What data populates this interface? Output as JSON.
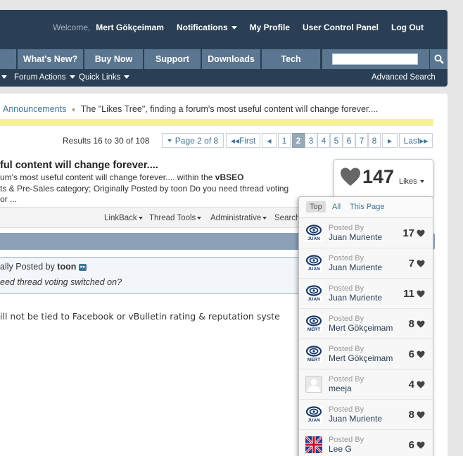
{
  "header": {
    "welcome": "Welcome,",
    "username": "Mert Gökçeimam",
    "links": [
      "Notifications",
      "My Profile",
      "User Control Panel",
      "Log Out"
    ]
  },
  "nav": {
    "tabs": [
      "What's New?",
      "Buy Now",
      "Support",
      "Downloads",
      "Tech"
    ],
    "search_placeholder": ""
  },
  "subnav": {
    "forum_actions": "Forum Actions",
    "quick_links": "Quick Links",
    "advanced_search": "Advanced Search"
  },
  "breadcrumb": {
    "parent": "Announcements",
    "current": "The \"Likes Tree\", finding a forum's most useful content will change forever...."
  },
  "results": {
    "text": "Results 16 to 30 of 108"
  },
  "pagination": {
    "page_of": "Page 2 of 8",
    "first": "First",
    "prev": "◂",
    "pages": [
      "1",
      "2",
      "3",
      "4",
      "5",
      "6",
      "7",
      "8"
    ],
    "current": "2",
    "next": "▸",
    "last": "Last"
  },
  "thread": {
    "title": "ful content will change forever....",
    "line1_pre": "um's most useful content will change forever.... within the ",
    "line1_bold": "vBSEO",
    "line2": "ts & Pre-Sales category; Originally Posted by toon Do you need thread voting",
    "line3": "or ..."
  },
  "toolbar": {
    "linkback": "LinkBack",
    "thread_tools": "Thread Tools",
    "administrative": "Administrative",
    "search": "Search"
  },
  "quote": {
    "prefix": "ally Posted by ",
    "author": "toon",
    "text": "eed thread voting switched on?"
  },
  "post": {
    "text": "ill not be tied to Facebook or vBulletin rating & reputation syste"
  },
  "likes": {
    "count": "147",
    "label": "Likes",
    "tabs": [
      "Top",
      "All",
      "This Page"
    ],
    "posted_by_label": "Posted By",
    "rows": [
      {
        "name": "Juan Muriente",
        "count": "17",
        "avatar": "JUAN"
      },
      {
        "name": "Juan Muriente",
        "count": "7",
        "avatar": "JUAN"
      },
      {
        "name": "Juan Muriente",
        "count": "11",
        "avatar": "JUAN"
      },
      {
        "name": "Mert Gökçeimam",
        "count": "8",
        "avatar": "MERT"
      },
      {
        "name": "Mert Gökçeimam",
        "count": "6",
        "avatar": "MERT"
      },
      {
        "name": "meeja",
        "count": "4",
        "avatar": ""
      },
      {
        "name": "Juan Muriente",
        "count": "8",
        "avatar": "JUAN"
      },
      {
        "name": "Lee G",
        "count": "6",
        "avatar": ""
      }
    ]
  },
  "colors": {
    "header_bg": "#2a3f55",
    "tab_bg": "#5a7690",
    "link": "#417394",
    "highlight_bar": "#f8ef9b"
  }
}
